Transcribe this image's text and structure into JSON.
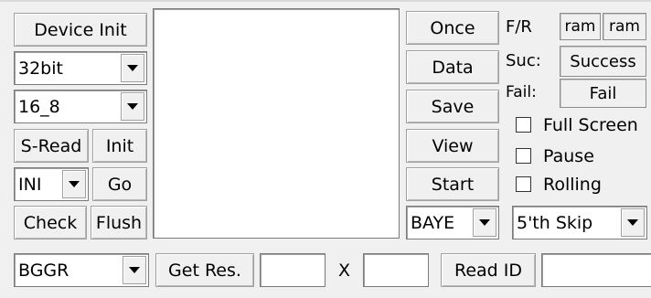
{
  "left": {
    "device_init": "Device Init",
    "bit_select": "32bit",
    "fmt_select": "16_8",
    "s_read": "S-Read",
    "init": "Init",
    "ini_select": "INI",
    "go": "Go",
    "check": "Check",
    "flush": "Flush"
  },
  "middle": {
    "once": "Once",
    "data": "Data",
    "save": "Save",
    "view": "View",
    "start": "Start",
    "baye_select": "BAYE"
  },
  "right": {
    "fr_label": "F/R",
    "fr_value1": "ram",
    "fr_value2": "ram",
    "suc_label": "Suc:",
    "suc_value": "Success",
    "fail_label": "Fail:",
    "fail_value": "Fail",
    "full_screen": "Full Screen",
    "pause": "Pause",
    "rolling": "Rolling",
    "skip_select": "5'th Skip"
  },
  "bottom": {
    "bggr_select": "BGGR",
    "get_res": "Get Res.",
    "width_value": "",
    "x_label": "X",
    "height_value": "",
    "read_id": "Read ID",
    "id_value": ""
  }
}
